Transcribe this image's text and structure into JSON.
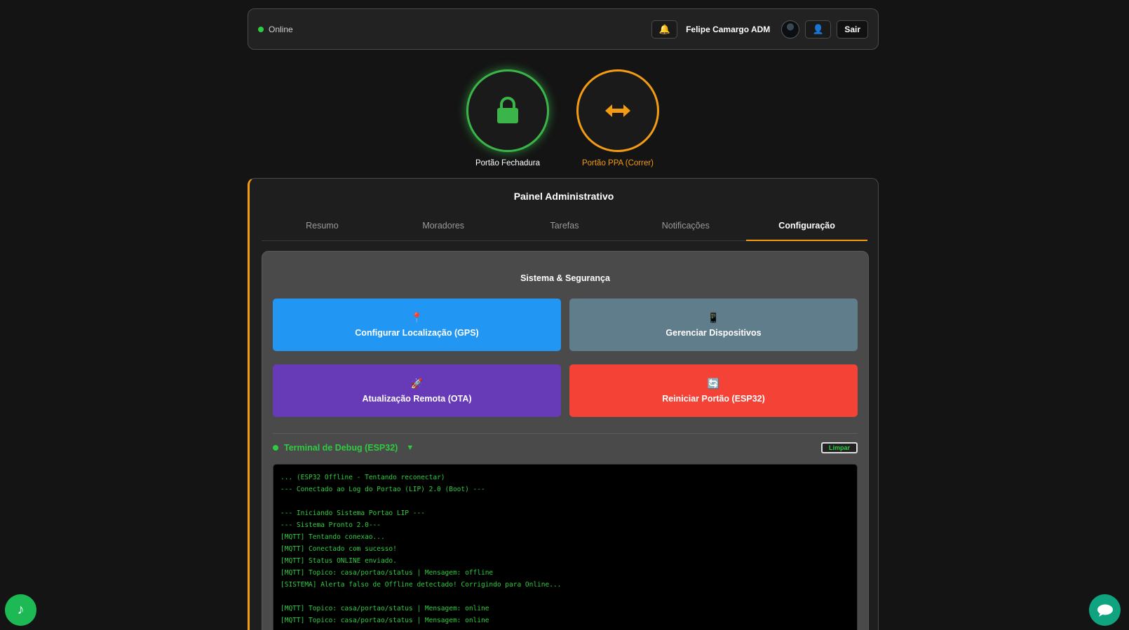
{
  "header": {
    "status": "Online",
    "bell_icon": "bell-icon",
    "user_name": "Felipe Camargo ADM",
    "profile_icon": "user-icon",
    "logout_label": "Sair"
  },
  "gates": [
    {
      "label": "Portão Fechadura",
      "icon": "lock-icon",
      "color": "#3bb54a"
    },
    {
      "label": "Portão PPA (Correr)",
      "icon": "arrows-left-right-icon",
      "color": "#f39c12"
    }
  ],
  "panel": {
    "title": "Painel Administrativo",
    "tabs": [
      {
        "label": "Resumo"
      },
      {
        "label": "Moradores"
      },
      {
        "label": "Tarefas"
      },
      {
        "label": "Notificações"
      },
      {
        "label": "Configuração",
        "active": true
      }
    ],
    "section_title": "Sistema & Segurança",
    "actions": [
      {
        "label": "Configurar Localização (GPS)",
        "icon": "📍",
        "color": "#2196f3"
      },
      {
        "label": "Gerenciar Dispositivos",
        "icon": "📱",
        "color": "#607d8b"
      },
      {
        "label": "Atualização Remota (OTA)",
        "icon": "🚀",
        "color": "#673ab7"
      },
      {
        "label": "Reiniciar Portão (ESP32)",
        "icon": "🔄",
        "color": "#f44336"
      }
    ],
    "terminal": {
      "title": "Terminal de Debug (ESP32)",
      "clear_label": "Limpar",
      "lines": [
        "... (ESP32 Offline - Tentando reconectar)",
        "--- Conectado ao Log do Portao (LIP) 2.0 (Boot) ---",
        "",
        "--- Iniciando Sistema Portao LIP ---",
        "--- Sistema Pronto 2.0---",
        "[MQTT] Tentando conexao...",
        "[MQTT] Conectado com sucesso!",
        "[MQTT] Status ONLINE enviado.",
        "[MQTT] Topico: casa/portao/status | Mensagem: offline",
        "[SISTEMA] Alerta falso de Offline detectado! Corrigindo para Online...",
        "",
        "[MQTT] Topico: casa/portao/status | Mensagem: online",
        "[MQTT] Topico: casa/portao/status | Mensagem: online"
      ]
    }
  },
  "floating": {
    "music_icon": "music-note-icon",
    "chat_icon": "chat-bubble-icon"
  }
}
